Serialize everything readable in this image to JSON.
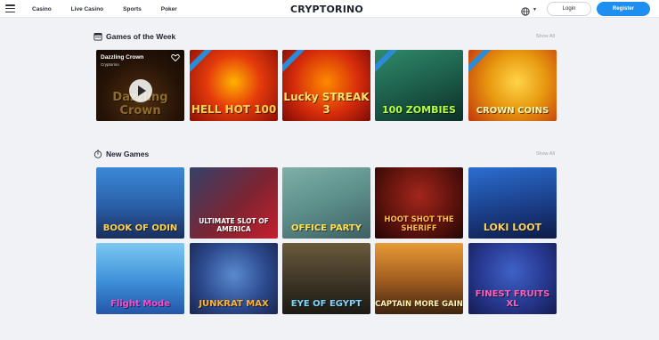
{
  "header": {
    "nav": [
      "Casino",
      "Live Casino",
      "Sports",
      "Poker"
    ],
    "logo": "CRYPTORINO",
    "login_label": "Login",
    "register_label": "Register",
    "language_icon": "globe-icon"
  },
  "sections": {
    "featured": {
      "title": "Games of the Week",
      "show_all": "Show All",
      "icon": "calendar-icon",
      "hovered": {
        "title": "Dazzling Crown",
        "provider": "Cryptorino"
      },
      "games": [
        {
          "name": "Dazzling Crown"
        },
        {
          "name": "HELL HOT 100"
        },
        {
          "name": "Lucky STREAK 3"
        },
        {
          "name": "100 ZOMBIES"
        },
        {
          "name": "CROWN COINS"
        }
      ]
    },
    "new_games": {
      "title": "New Games",
      "show_all": "Show All",
      "icon": "stopwatch-icon",
      "games": [
        {
          "name": "BOOK OF ODIN"
        },
        {
          "name": "ULTIMATE SLOT OF AMERICA"
        },
        {
          "name": "OFFICE PARTY"
        },
        {
          "name": "HOOT SHOT THE SHERIFF"
        },
        {
          "name": "LOKI LOOT"
        },
        {
          "name": "Flight Mode"
        },
        {
          "name": "JUNKRAT MAX"
        },
        {
          "name": "EYE OF EGYPT"
        },
        {
          "name": "CAPTAIN MORE GAIN"
        },
        {
          "name": "FINEST FRUITS XL"
        }
      ]
    }
  }
}
